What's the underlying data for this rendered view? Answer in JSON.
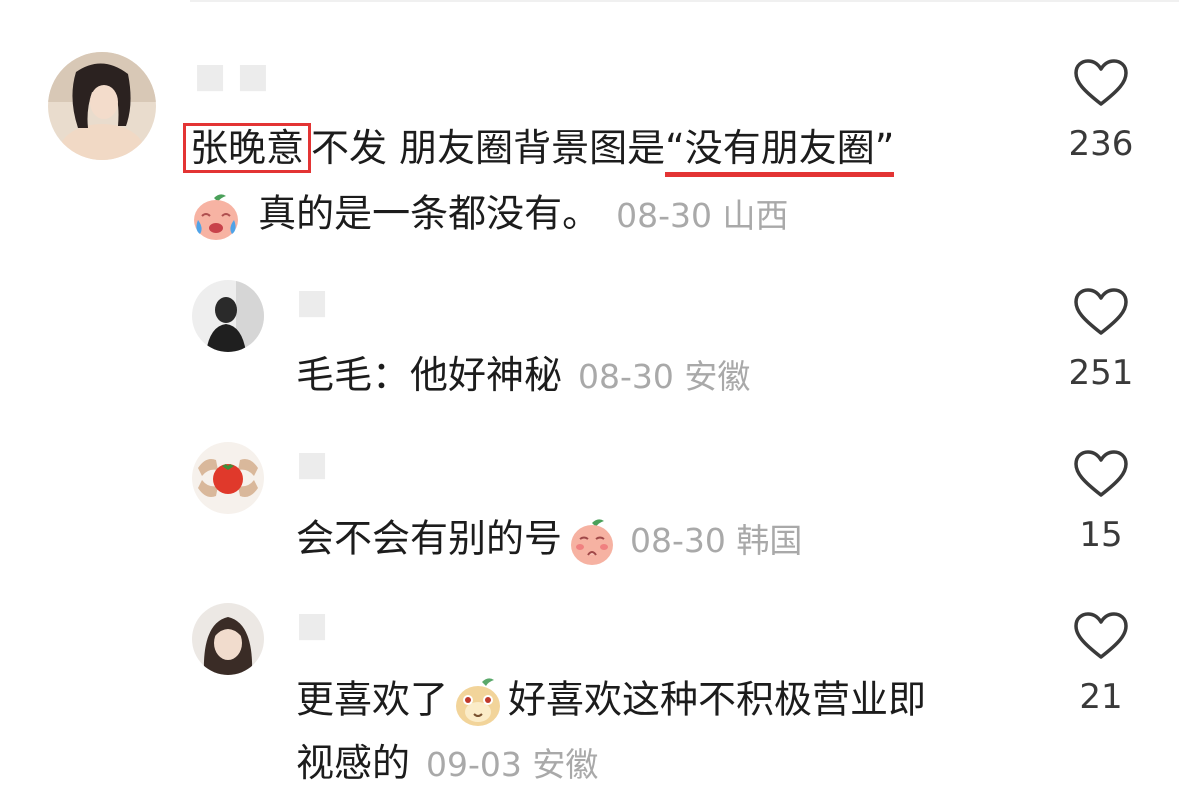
{
  "comments": [
    {
      "highlighted_name": "张晚意",
      "text_before_quote": "不发 朋友圈背景图是",
      "quoted_text": "“没有朋友圈”",
      "text_line2": "真的是一条都没有。",
      "date": "08-30",
      "location": "山西",
      "likes": "236",
      "emoji": "crying-sticker-icon"
    },
    {
      "text": "毛毛：他好神秘",
      "date": "08-30",
      "location": "安徽",
      "likes": "251"
    },
    {
      "text": "会不会有别的号",
      "date": "08-30",
      "location": "韩国",
      "likes": "15",
      "emoji": "shy-sticker-icon"
    },
    {
      "text_part1": "更喜欢了",
      "text_part2": "好喜欢这种不积极营业即",
      "text_line2": "视感的",
      "date": "09-03",
      "location": "安徽",
      "likes": "21",
      "emoji": "cute-face-sticker-icon"
    }
  ],
  "colors": {
    "highlight_red": "#e33434",
    "meta_gray": "#a9a9a9",
    "text": "#1c1c1c"
  }
}
